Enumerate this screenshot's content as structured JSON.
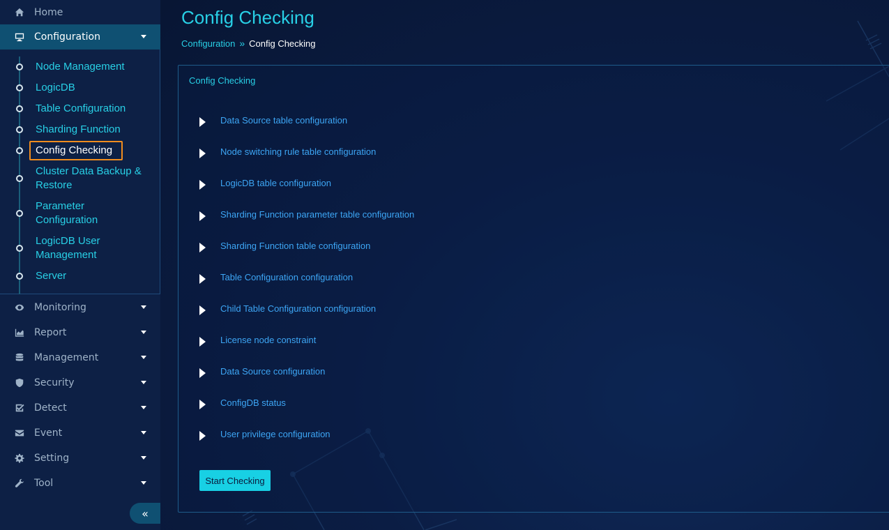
{
  "sidebar": {
    "menu": [
      {
        "label": "Home",
        "icon": "home-icon"
      },
      {
        "label": "Configuration",
        "icon": "monitor-icon"
      },
      {
        "label": "Monitoring",
        "icon": "eye-icon"
      },
      {
        "label": "Report",
        "icon": "area-chart-icon"
      },
      {
        "label": "Management",
        "icon": "database-icon"
      },
      {
        "label": "Security",
        "icon": "shield-icon"
      },
      {
        "label": "Detect",
        "icon": "check-square-icon"
      },
      {
        "label": "Event",
        "icon": "envelope-icon"
      },
      {
        "label": "Setting",
        "icon": "gear-icon"
      },
      {
        "label": "Tool",
        "icon": "wrench-icon"
      }
    ],
    "active_menu": "Configuration",
    "submenu": [
      "Node Management",
      "LogicDB",
      "Table Configuration",
      "Sharding Function",
      "Config Checking",
      "Cluster Data Backup & Restore",
      "Parameter Configuration",
      "LogicDB User Management",
      "Server"
    ],
    "current_submenu": "Config Checking",
    "collapse_glyph": "«"
  },
  "main": {
    "title": "Config Checking",
    "breadcrumb": {
      "parent": "Configuration",
      "separator": "»",
      "current": "Config Checking"
    },
    "panel": {
      "title": "Config Checking",
      "items": [
        "Data Source table configuration",
        "Node switching rule table configuration",
        "LogicDB table configuration",
        "Sharding Function parameter table configuration",
        "Sharding Function table configuration",
        "Table Configuration configuration",
        "Child Table Configuration configuration",
        "License node constraint",
        "Data Source configuration",
        "ConfigDB status",
        "User privilege configuration"
      ],
      "start_button": "Start Checking"
    }
  },
  "colors": {
    "accent": "#28d0e6",
    "link": "#3da6f5",
    "highlight_border": "#f08c1e",
    "sidebar_bg": "#0d2045",
    "active_bg": "#0f5072",
    "button_bg": "#18d0e4"
  }
}
